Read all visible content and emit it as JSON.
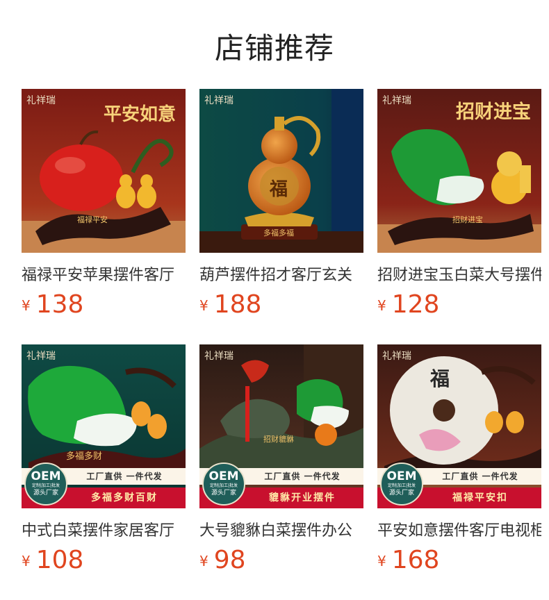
{
  "section_title": "店铺推荐",
  "brand_logo": "礼祥瑞",
  "currency": "¥",
  "products": [
    {
      "name": "福禄平安苹果摆件客厅",
      "price": "138",
      "image_text": "平安如意",
      "image_subtext": "福禄平安"
    },
    {
      "name": "葫芦摆件招才客厅玄关",
      "price": "188",
      "image_text": "福",
      "image_subtext": "多福多福"
    },
    {
      "name": "招财进宝玉白菜大号摆件",
      "price": "128",
      "image_text": "招财进宝",
      "image_subtext": "招财进宝"
    },
    {
      "name": "中式白菜摆件家居客厅",
      "price": "108",
      "image_text": "多福多财",
      "banner_bottom": "多福多财百财"
    },
    {
      "name": "大号貔貅白菜摆件办公",
      "price": "98",
      "image_text": "招财貔貅",
      "banner_bottom": "貔貅开业摆件"
    },
    {
      "name": "平安如意摆件客厅电视柜",
      "price": "168",
      "image_text": "福",
      "banner_bottom": "福禄平安扣"
    }
  ],
  "oem_badge": {
    "title": "OEM",
    "line1": "定制|加工|批发",
    "line2": "源头厂家"
  },
  "oem_banner_top": "工厂直供 一件代发"
}
